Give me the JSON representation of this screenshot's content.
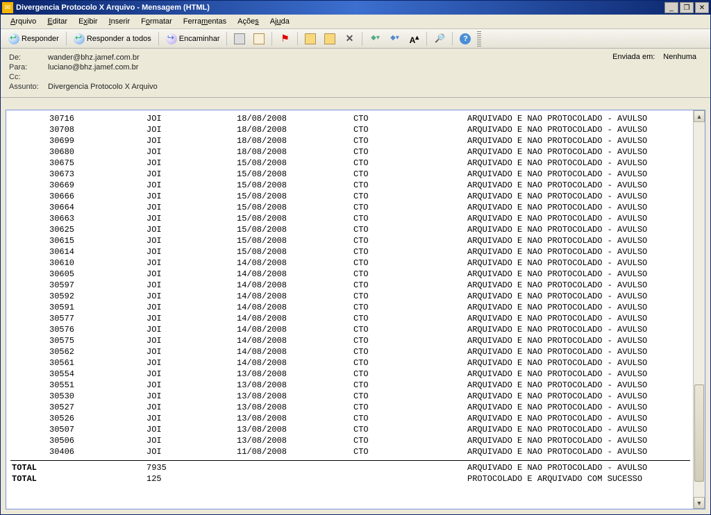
{
  "window": {
    "title": "Divergencia Protocolo X Arquivo - Mensagem (HTML)"
  },
  "menu": {
    "arquivo": "Arquivo",
    "editar": "Editar",
    "exibir": "Exibir",
    "inserir": "Inserir",
    "formatar": "Formatar",
    "ferramentas": "Ferramentas",
    "acoes": "Ações",
    "ajuda": "Ajuda"
  },
  "toolbar": {
    "responder": "Responder",
    "responder_todos": "Responder a todos",
    "encaminhar": "Encaminhar"
  },
  "header": {
    "de_label": "De:",
    "de_value": "wander@bhz.jamef.com.br",
    "para_label": "Para:",
    "para_value": "luciano@bhz.jamef.com.br",
    "cc_label": "Cc:",
    "cc_value": "",
    "assunto_label": "Assunto:",
    "assunto_value": "Divergencia Protocolo X Arquivo",
    "enviada_label": "Enviada em:",
    "enviada_value": "Nenhuma"
  },
  "rows": [
    {
      "id": "30716",
      "loc": "JOI",
      "date": "18/08/2008",
      "type": "CTO",
      "status": "ARQUIVADO E NAO PROTOCOLADO - AVULSO"
    },
    {
      "id": "30708",
      "loc": "JOI",
      "date": "18/08/2008",
      "type": "CTO",
      "status": "ARQUIVADO E NAO PROTOCOLADO - AVULSO"
    },
    {
      "id": "30699",
      "loc": "JOI",
      "date": "18/08/2008",
      "type": "CTO",
      "status": "ARQUIVADO E NAO PROTOCOLADO - AVULSO"
    },
    {
      "id": "30680",
      "loc": "JOI",
      "date": "18/08/2008",
      "type": "CTO",
      "status": "ARQUIVADO E NAO PROTOCOLADO - AVULSO"
    },
    {
      "id": "30675",
      "loc": "JOI",
      "date": "15/08/2008",
      "type": "CTO",
      "status": "ARQUIVADO E NAO PROTOCOLADO - AVULSO"
    },
    {
      "id": "30673",
      "loc": "JOI",
      "date": "15/08/2008",
      "type": "CTO",
      "status": "ARQUIVADO E NAO PROTOCOLADO - AVULSO"
    },
    {
      "id": "30669",
      "loc": "JOI",
      "date": "15/08/2008",
      "type": "CTO",
      "status": "ARQUIVADO E NAO PROTOCOLADO - AVULSO"
    },
    {
      "id": "30666",
      "loc": "JOI",
      "date": "15/08/2008",
      "type": "CTO",
      "status": "ARQUIVADO E NAO PROTOCOLADO - AVULSO"
    },
    {
      "id": "30664",
      "loc": "JOI",
      "date": "15/08/2008",
      "type": "CTO",
      "status": "ARQUIVADO E NAO PROTOCOLADO - AVULSO"
    },
    {
      "id": "30663",
      "loc": "JOI",
      "date": "15/08/2008",
      "type": "CTO",
      "status": "ARQUIVADO E NAO PROTOCOLADO - AVULSO"
    },
    {
      "id": "30625",
      "loc": "JOI",
      "date": "15/08/2008",
      "type": "CTO",
      "status": "ARQUIVADO E NAO PROTOCOLADO - AVULSO"
    },
    {
      "id": "30615",
      "loc": "JOI",
      "date": "15/08/2008",
      "type": "CTO",
      "status": "ARQUIVADO E NAO PROTOCOLADO - AVULSO"
    },
    {
      "id": "30614",
      "loc": "JOI",
      "date": "15/08/2008",
      "type": "CTO",
      "status": "ARQUIVADO E NAO PROTOCOLADO - AVULSO"
    },
    {
      "id": "30610",
      "loc": "JOI",
      "date": "14/08/2008",
      "type": "CTO",
      "status": "ARQUIVADO E NAO PROTOCOLADO - AVULSO"
    },
    {
      "id": "30605",
      "loc": "JOI",
      "date": "14/08/2008",
      "type": "CTO",
      "status": "ARQUIVADO E NAO PROTOCOLADO - AVULSO"
    },
    {
      "id": "30597",
      "loc": "JOI",
      "date": "14/08/2008",
      "type": "CTO",
      "status": "ARQUIVADO E NAO PROTOCOLADO - AVULSO"
    },
    {
      "id": "30592",
      "loc": "JOI",
      "date": "14/08/2008",
      "type": "CTO",
      "status": "ARQUIVADO E NAO PROTOCOLADO - AVULSO"
    },
    {
      "id": "30591",
      "loc": "JOI",
      "date": "14/08/2008",
      "type": "CTO",
      "status": "ARQUIVADO E NAO PROTOCOLADO - AVULSO"
    },
    {
      "id": "30577",
      "loc": "JOI",
      "date": "14/08/2008",
      "type": "CTO",
      "status": "ARQUIVADO E NAO PROTOCOLADO - AVULSO"
    },
    {
      "id": "30576",
      "loc": "JOI",
      "date": "14/08/2008",
      "type": "CTO",
      "status": "ARQUIVADO E NAO PROTOCOLADO - AVULSO"
    },
    {
      "id": "30575",
      "loc": "JOI",
      "date": "14/08/2008",
      "type": "CTO",
      "status": "ARQUIVADO E NAO PROTOCOLADO - AVULSO"
    },
    {
      "id": "30562",
      "loc": "JOI",
      "date": "14/08/2008",
      "type": "CTO",
      "status": "ARQUIVADO E NAO PROTOCOLADO - AVULSO"
    },
    {
      "id": "30561",
      "loc": "JOI",
      "date": "14/08/2008",
      "type": "CTO",
      "status": "ARQUIVADO E NAO PROTOCOLADO - AVULSO"
    },
    {
      "id": "30554",
      "loc": "JOI",
      "date": "13/08/2008",
      "type": "CTO",
      "status": "ARQUIVADO E NAO PROTOCOLADO - AVULSO"
    },
    {
      "id": "30551",
      "loc": "JOI",
      "date": "13/08/2008",
      "type": "CTO",
      "status": "ARQUIVADO E NAO PROTOCOLADO - AVULSO"
    },
    {
      "id": "30530",
      "loc": "JOI",
      "date": "13/08/2008",
      "type": "CTO",
      "status": "ARQUIVADO E NAO PROTOCOLADO - AVULSO"
    },
    {
      "id": "30527",
      "loc": "JOI",
      "date": "13/08/2008",
      "type": "CTO",
      "status": "ARQUIVADO E NAO PROTOCOLADO - AVULSO"
    },
    {
      "id": "30526",
      "loc": "JOI",
      "date": "13/08/2008",
      "type": "CTO",
      "status": "ARQUIVADO E NAO PROTOCOLADO - AVULSO"
    },
    {
      "id": "30507",
      "loc": "JOI",
      "date": "13/08/2008",
      "type": "CTO",
      "status": "ARQUIVADO E NAO PROTOCOLADO - AVULSO"
    },
    {
      "id": "30506",
      "loc": "JOI",
      "date": "13/08/2008",
      "type": "CTO",
      "status": "ARQUIVADO E NAO PROTOCOLADO - AVULSO"
    },
    {
      "id": "30406",
      "loc": "JOI",
      "date": "11/08/2008",
      "type": "CTO",
      "status": "ARQUIVADO E NAO PROTOCOLADO - AVULSO"
    }
  ],
  "totals": [
    {
      "label": "TOTAL",
      "value": "7935",
      "status": "ARQUIVADO E NAO PROTOCOLADO - AVULSO"
    },
    {
      "label": "TOTAL",
      "value": "125",
      "status": "PROTOCOLADO E ARQUIVADO COM SUCESSO"
    }
  ]
}
